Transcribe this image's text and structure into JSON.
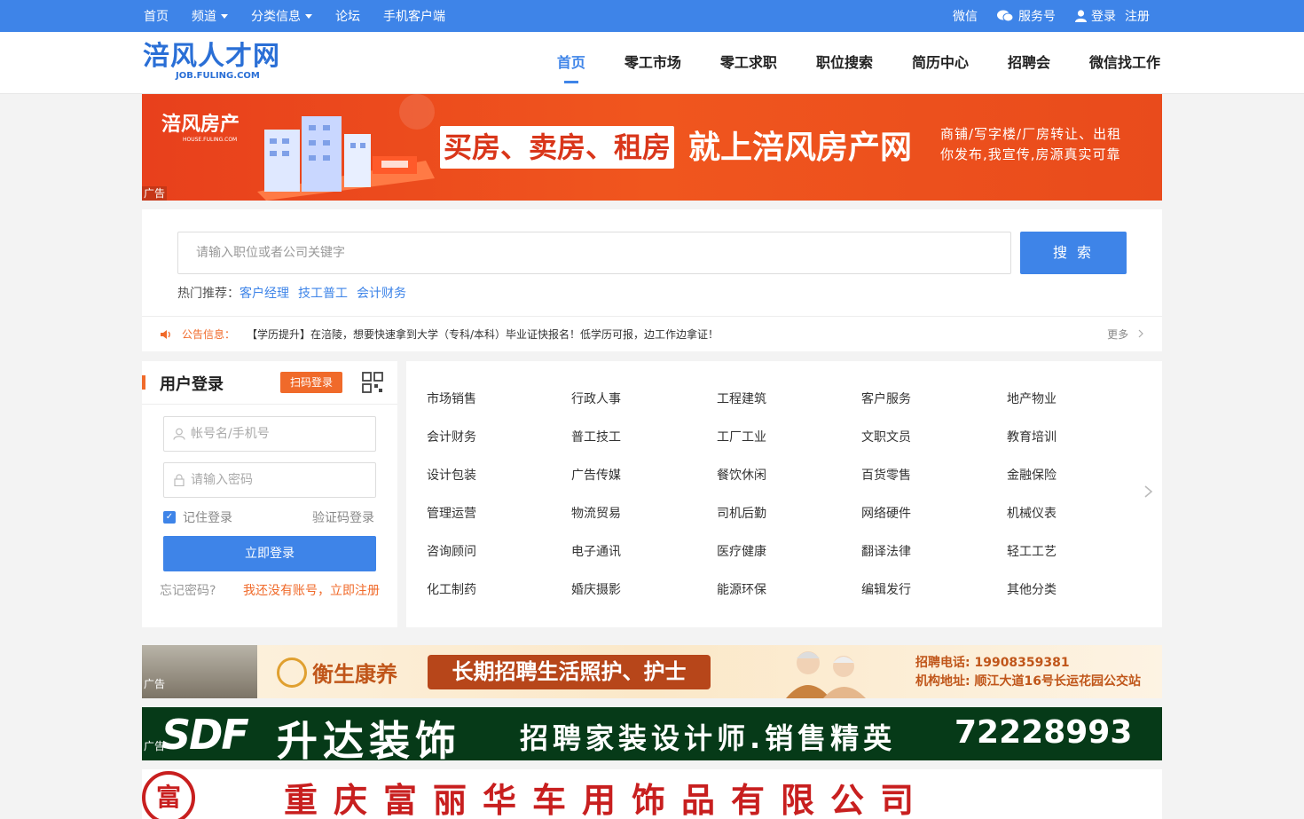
{
  "topbar": {
    "links": [
      "首页",
      "频道",
      "分类信息",
      "论坛",
      "手机客户端"
    ],
    "right": {
      "wechat": "微信",
      "service": "服务号",
      "login": "登录",
      "register": "注册"
    }
  },
  "logo": {
    "cn": "涪风人才网",
    "en": "JOB.FULING.COM"
  },
  "nav": [
    "首页",
    "零工市场",
    "零工求职",
    "职位搜索",
    "简历中心",
    "招聘会",
    "微信找工作"
  ],
  "ad_label": "广告",
  "banner_house": {
    "logo": "涪风房产",
    "logo_sub": "HOUSE.FULING.COM",
    "box": "买房、卖房、租房",
    "slogan": "就上涪风房产网",
    "line1": "商铺/写字楼/厂房转让、出租",
    "line2": "你发布,我宣传,房源真实可靠"
  },
  "search": {
    "placeholder": "请输入职位或者公司关键字",
    "button": "搜 索",
    "hot_label": "热门推荐：",
    "hot": [
      "客户经理",
      "技工普工",
      "会计财务"
    ]
  },
  "notice": {
    "label": "公告信息：",
    "text": "【学历提升】在涪陵，想要快速拿到大学（专科/本科）毕业证快报名！低学历可报，边工作边拿证！",
    "more": "更多"
  },
  "login": {
    "title": "用户登录",
    "scan": "扫码登录",
    "user_placeholder": "帐号名/手机号",
    "pass_placeholder": "请输入密码",
    "remember": "记住登录",
    "code_login": "验证码登录",
    "submit": "立即登录",
    "forgot": "忘记密码?",
    "register": "我还没有账号，立即注册"
  },
  "categories": [
    [
      "市场销售",
      "行政人事",
      "工程建筑",
      "客户服务",
      "地产物业"
    ],
    [
      "会计财务",
      "普工技工",
      "工厂工业",
      "文职文员",
      "教育培训"
    ],
    [
      "设计包装",
      "广告传媒",
      "餐饮休闲",
      "百货零售",
      "金融保险"
    ],
    [
      "管理运营",
      "物流贸易",
      "司机后勤",
      "网络硬件",
      "机械仪表"
    ],
    [
      "咨询顾问",
      "电子通讯",
      "医疗健康",
      "翻译法律",
      "轻工工艺"
    ],
    [
      "化工制药",
      "婚庆摄影",
      "能源环保",
      "编辑发行",
      "其他分类"
    ]
  ],
  "banner_care": {
    "brand": "衡生康养",
    "pill": "长期招聘生活照护、护士",
    "phone": "招聘电话: 19908359381",
    "address": "机构地址: 顺江大道16号长运花园公交站"
  },
  "banner_sdf": {
    "logo": "SDF",
    "name": "升达装饰",
    "job": "招聘家装设计师.销售精英",
    "tel": "72228993"
  },
  "banner_fulihua": {
    "logo": "富",
    "company": "重庆富丽华车用饰品有限公司"
  },
  "colors": {
    "primary": "#3e84e8",
    "accent": "#f06a2a"
  }
}
